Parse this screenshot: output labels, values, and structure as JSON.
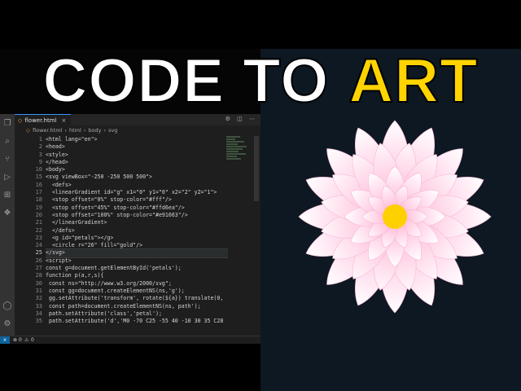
{
  "thumbnail": {
    "title_white": "CODE TO",
    "title_yellow": "ART",
    "colors": {
      "title_white": "#ffffff",
      "title_yellow": "#ffd400",
      "art_bg": "#0d1822",
      "editor_bg": "#1e1e1e"
    }
  },
  "editor": {
    "tab": {
      "file_name": "flower.html",
      "file_icon": "html-file-icon"
    },
    "breadcrumb": {
      "file": "flower.html",
      "items": [
        "html",
        "body",
        "svg"
      ]
    },
    "current_line": "25",
    "lines": [
      {
        "n": "1",
        "code": "<html lang=\"en\">"
      },
      {
        "n": "2",
        "code": "<head>"
      },
      {
        "n": "3",
        "code": "<style>"
      },
      {
        "n": "9",
        "code": "</head>"
      },
      {
        "n": "10",
        "code": "<body>"
      },
      {
        "n": "15",
        "code": "<svg viewBox=\"-250 -250 500 500\">"
      },
      {
        "n": "16",
        "code": "  <defs>"
      },
      {
        "n": "17",
        "code": "  <linearGradient id=\"g\" x1=\"0\" y1=\"0\" x2=\"2\" y2=\"1\">"
      },
      {
        "n": "18",
        "code": "  <stop offset=\"0%\" stop-color=\"#fff\"/>"
      },
      {
        "n": "19",
        "code": "  <stop offset=\"45%\" stop-color=\"#ffd6ea\"/>"
      },
      {
        "n": "20",
        "code": "  <stop offset=\"100%\" stop-color=\"#e91663\"/>"
      },
      {
        "n": "21",
        "code": "  </linearGradient>"
      },
      {
        "n": "22",
        "code": "  </defs>"
      },
      {
        "n": "23",
        "code": "  <g id=\"petals\"></g>"
      },
      {
        "n": "24",
        "code": "  <circle r=\"26\" fill=\"gold\"/>"
      },
      {
        "n": "25",
        "code": "</svg>"
      },
      {
        "n": "26",
        "code": "<script>"
      },
      {
        "n": "27",
        "code": "const g=document.getElementById('petals');"
      },
      {
        "n": "28",
        "code": "function p(a,r,s){"
      },
      {
        "n": "30",
        "code": " const ns=\"http://www.w3.org/2000/svg\";"
      },
      {
        "n": "31",
        "code": " const gg=document.createElementNS(ns,'g');"
      },
      {
        "n": "32",
        "code": " gg.setAttribute('transform', rotate(${a}) translate(0,"
      },
      {
        "n": "33",
        "code": " const path=document.createElementNS(ns, path');"
      },
      {
        "n": "34",
        "code": " path.setAttribute('class','petal');"
      },
      {
        "n": "35",
        "code": " path.setAttribute('d','M0 -70 C25 -55 40 -10 30 35 C28"
      }
    ],
    "status": {
      "errors": "0",
      "warnings": "0"
    }
  }
}
